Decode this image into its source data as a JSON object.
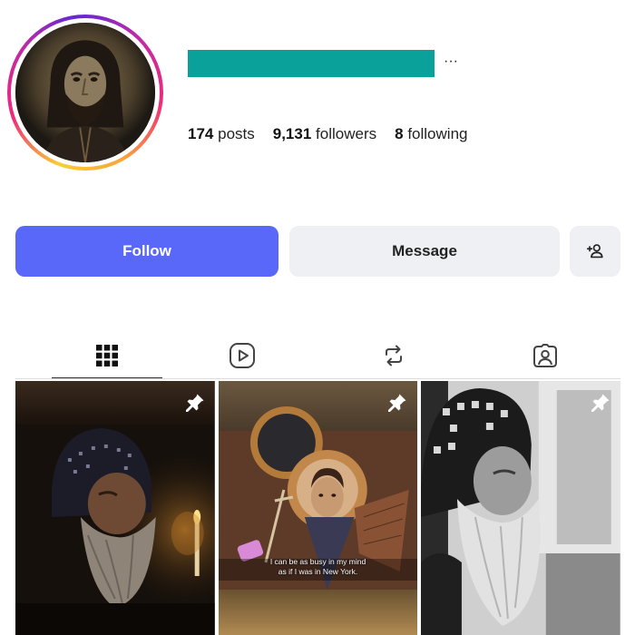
{
  "profile": {
    "username_redacted_color": "#0aa19a",
    "more_label": "···",
    "avatar_icon": "byzantine-icon-avatar"
  },
  "stats": {
    "posts_count": "174",
    "posts_label": "posts",
    "followers_count": "9,131",
    "followers_label": "followers",
    "following_count": "8",
    "following_label": "following"
  },
  "actions": {
    "follow_label": "Follow",
    "message_label": "Message",
    "suggest_icon": "add-person-icon",
    "follow_color": "#5968f8"
  },
  "tabs": [
    {
      "icon": "grid-icon",
      "active": true
    },
    {
      "icon": "reels-icon",
      "active": false
    },
    {
      "icon": "reposts-icon",
      "active": false
    },
    {
      "icon": "tagged-icon",
      "active": false
    }
  ],
  "posts": [
    {
      "pinned": true,
      "icon": "pin-icon",
      "caption": ""
    },
    {
      "pinned": true,
      "icon": "pin-icon",
      "caption_line1": "I can be as busy in my mind",
      "caption_line2": "as if I was in New York."
    },
    {
      "pinned": true,
      "icon": "pin-icon",
      "caption": ""
    }
  ]
}
